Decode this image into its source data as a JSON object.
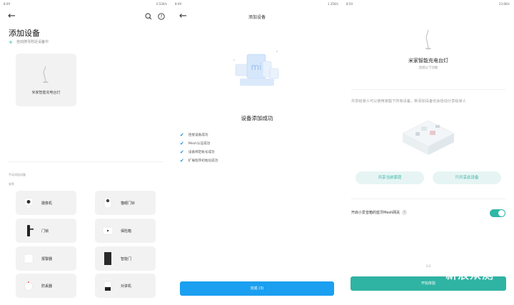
{
  "status_bars": [
    {
      "time": "8:49",
      "right": "0.52K/s"
    },
    {
      "time": "8:49",
      "right": "1.35K/s"
    },
    {
      "time": "8:50",
      "right": "23.6K/s"
    }
  ],
  "screen1": {
    "title": "添加设备",
    "scanning_text": "自动搜寻附近设备中",
    "found_device": "米家智能充电台灯",
    "section_label": "手动添加设备",
    "category": "安防",
    "devices": [
      {
        "name": "摄像机",
        "icon": "camera-icon"
      },
      {
        "name": "猫眼门铃",
        "icon": "doorbell-icon"
      },
      {
        "name": "门锁",
        "icon": "door-lock-icon"
      },
      {
        "name": "保险箱",
        "icon": "safe-icon"
      },
      {
        "name": "报警器",
        "icon": "alarm-icon"
      },
      {
        "name": "智能门",
        "icon": "smart-door-icon"
      },
      {
        "name": "防丢器",
        "icon": "tracker-icon"
      },
      {
        "name": "对讲机",
        "icon": "intercom-icon"
      }
    ]
  },
  "screen2": {
    "title": "添加设备",
    "success_text": "设备添加成功",
    "steps": [
      "连接设备成功",
      "Mesh认证成功",
      "设备绑定账号成功",
      "扩展程序初始化成功"
    ],
    "done_button": "完成 (3)"
  },
  "screen3": {
    "device_name": "米家智能充电台灯",
    "device_sub": "连接以下功能",
    "share_text": "共享给家人可以使用家庭下所有设备，新添加设备也会自动分享给家人",
    "share_home_button": "共享当前家庭",
    "share_device_button": "只共享此设备",
    "mesh_label": "开启小爱音箱的蓝牙Mesh网关",
    "mesh_enabled": true,
    "page_indicator": "2/3",
    "start_button": "开始体验"
  },
  "watermark": "新浪众测",
  "colors": {
    "teal": "#2fb3a3",
    "blue": "#1b9ff0"
  }
}
